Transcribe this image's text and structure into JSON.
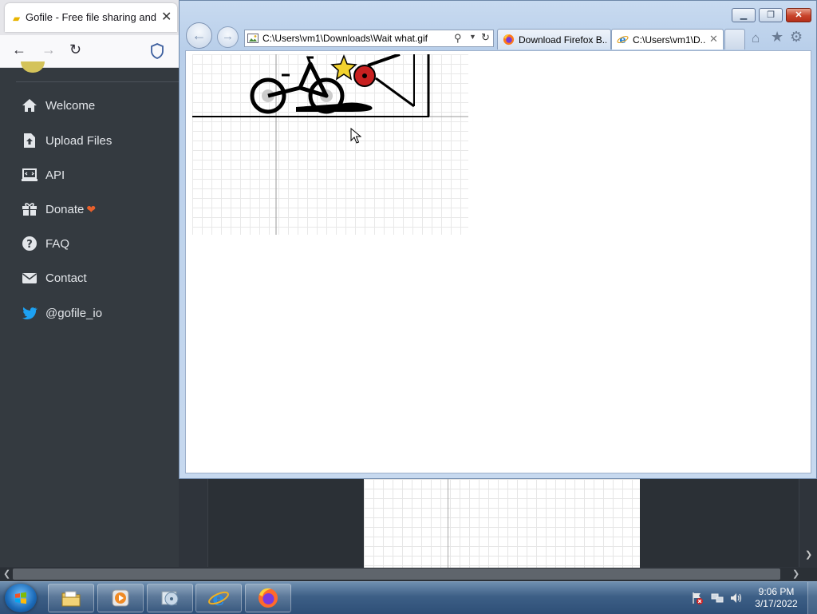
{
  "background_browser": {
    "tab_title": "Gofile - Free file sharing and storage",
    "tab_close": "✕",
    "nav": {
      "back": "←",
      "forward": "→",
      "reload": "↻"
    }
  },
  "gofile": {
    "menu": [
      {
        "label": "Welcome",
        "icon": "home-icon"
      },
      {
        "label": "Upload Files",
        "icon": "file-upload-icon"
      },
      {
        "label": "API",
        "icon": "laptop-code-icon"
      },
      {
        "label": "Donate",
        "icon": "gift-icon",
        "badge": "❤"
      },
      {
        "label": "FAQ",
        "icon": "question-circle-icon"
      },
      {
        "label": "Contact",
        "icon": "envelope-icon"
      },
      {
        "label": "@gofile_io",
        "icon": "twitter-icon"
      }
    ]
  },
  "ie": {
    "window_controls": {
      "minimize": "▁",
      "maximize": "❐",
      "close": "✕"
    },
    "nav": {
      "back": "←",
      "forward": "→"
    },
    "address": "C:\\Users\\vm1\\Downloads\\Wait what.gif",
    "tabs": [
      {
        "title": "Download Firefox B...",
        "icon": "firefox-icon",
        "active": false
      },
      {
        "title": "C:\\Users\\vm1\\D...",
        "icon": "ie-icon",
        "active": true,
        "close": "✕"
      }
    ],
    "toolbar": {
      "home": "⌂",
      "favorites": "★",
      "tools": "⚙"
    }
  },
  "taskbar": {
    "pinned": [
      "explorer-icon",
      "media-player-icon",
      "media-center-icon",
      "internet-explorer-icon",
      "firefox-icon"
    ],
    "clock": {
      "time": "9:06 PM",
      "date": "3/17/2022"
    }
  }
}
